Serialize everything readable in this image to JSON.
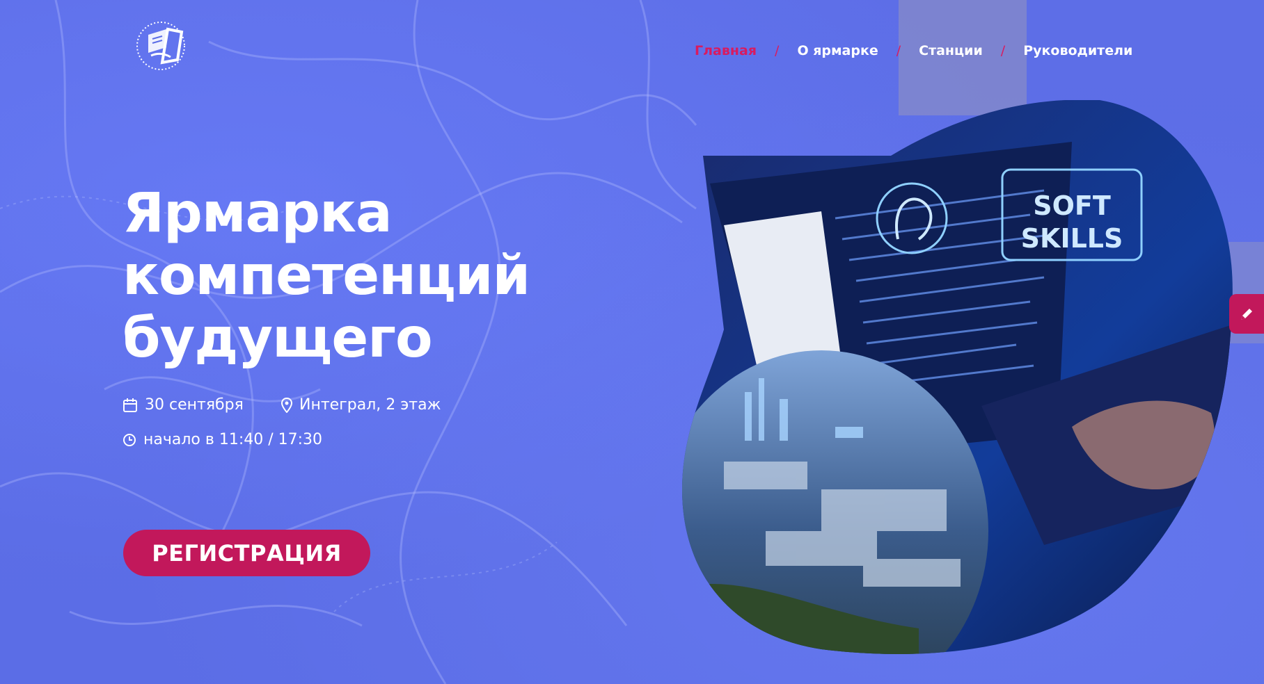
{
  "header": {
    "logo_alt": "университет логотип",
    "nav": [
      {
        "label": "Главная",
        "active": true
      },
      {
        "label": "О ярмарке",
        "active": false
      },
      {
        "label": "Станции",
        "active": false
      },
      {
        "label": "Руководители",
        "active": false
      }
    ],
    "separator": "/"
  },
  "hero": {
    "title_lines": [
      "Ярмарка",
      "компетенций",
      "будущего"
    ],
    "date": "30 сентября",
    "location": "Интеграл, 2 этаж",
    "time": "начало в 11:40 / 17:30",
    "register_label": "РЕГИСТРАЦИЯ",
    "image_text": "SOFT SKILLS"
  },
  "colors": {
    "accent": "#c2185b",
    "nav_active": "#d81b60",
    "background": "#5b6de6"
  },
  "icons": {
    "date": "calendar-icon",
    "location": "map-pin-icon",
    "time": "clock-icon",
    "edit": "pencil-icon"
  }
}
